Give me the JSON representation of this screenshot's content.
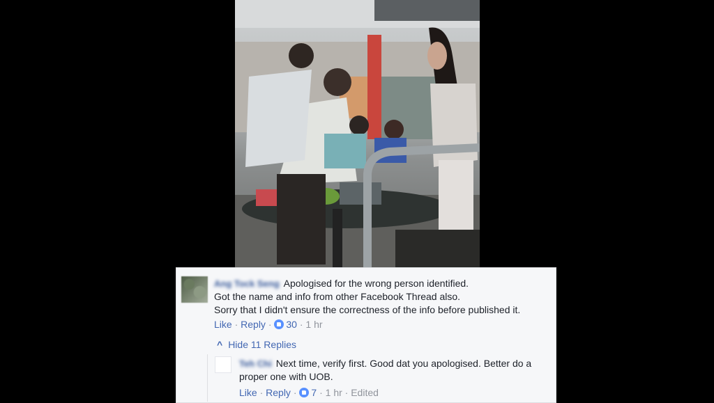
{
  "comment": {
    "author": "Ang Tock Seng",
    "lines": [
      "Apologised for the wrong person identified.",
      "Got the name and info from other Facebook Thread also.",
      "Sorry that I didn't ensure the correctness of the info before published it."
    ],
    "like_label": "Like",
    "reply_label": "Reply",
    "reactions": "30",
    "time": "1 hr"
  },
  "replies_toggle": {
    "label": "Hide 11 Replies"
  },
  "reply": {
    "author": "Teh Chi",
    "text": "Next time, verify first. Good dat you apologised. Better do a proper one with UOB.",
    "like_label": "Like",
    "reply_label": "Reply",
    "reactions": "7",
    "time": "1 hr",
    "edited": "Edited"
  },
  "colors": {
    "link": "#4267b2",
    "muted": "#90949c",
    "text": "#1d2129",
    "panel": "#f6f7f9",
    "like": "#5890ff"
  }
}
